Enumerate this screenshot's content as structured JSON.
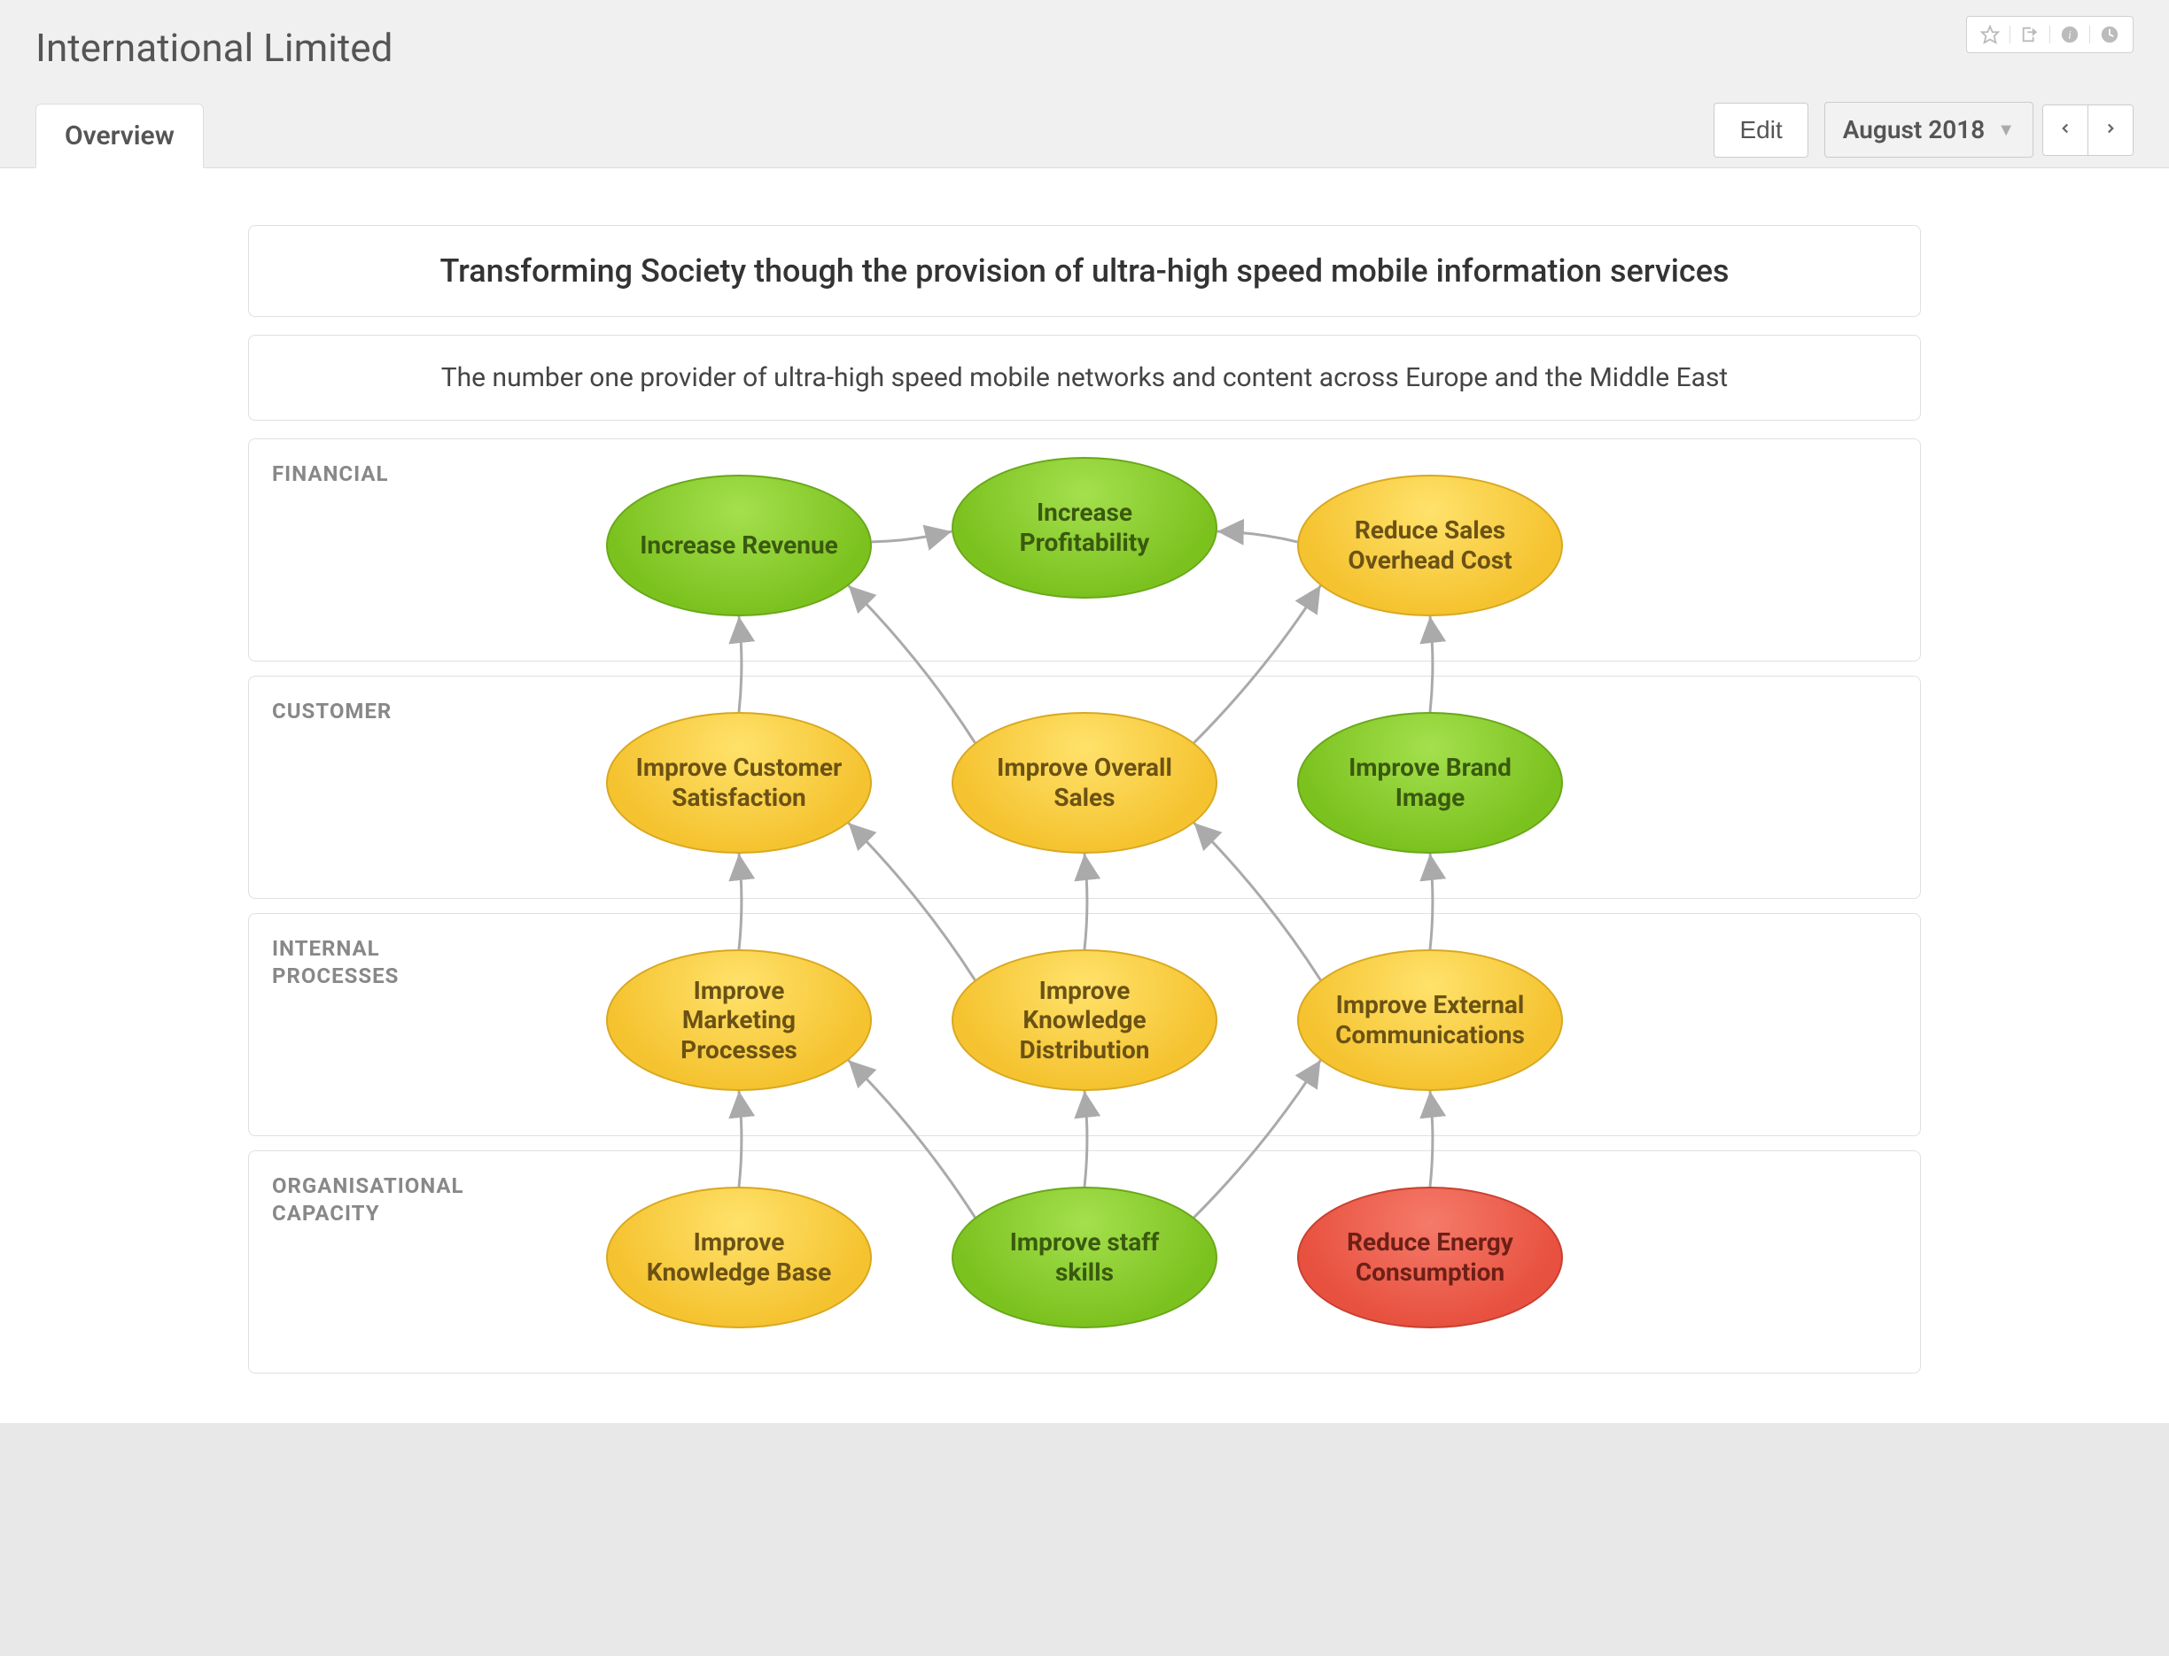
{
  "header": {
    "title": "International Limited",
    "tab_label": "Overview",
    "edit_label": "Edit",
    "period_label": "August 2018"
  },
  "banners": {
    "vision": "Transforming Society though the provision of ultra-high speed mobile information services",
    "mission": "The number one provider of ultra-high speed mobile networks and content across Europe and the Middle East"
  },
  "sections": {
    "financial": {
      "label": "FINANCIAL"
    },
    "customer": {
      "label": "CUSTOMER"
    },
    "internal": {
      "label": "INTERNAL PROCESSES"
    },
    "org": {
      "label": "ORGANISATIONAL CAPACITY"
    }
  },
  "nodes": {
    "increase_revenue": {
      "label": "Increase Revenue",
      "color": "green"
    },
    "increase_profitability": {
      "label": "Increase Profitability",
      "color": "green"
    },
    "reduce_overhead": {
      "label": "Reduce Sales Overhead Cost",
      "color": "yellow"
    },
    "improve_cust_sat": {
      "label": "Improve Customer Satisfaction",
      "color": "yellow"
    },
    "improve_overall_sales": {
      "label": "Improve Overall Sales",
      "color": "yellow"
    },
    "improve_brand": {
      "label": "Improve Brand Image",
      "color": "green"
    },
    "improve_marketing": {
      "label": "Improve Marketing Processes",
      "color": "yellow"
    },
    "improve_knowledge_dist": {
      "label": "Improve Knowledge Distribution",
      "color": "yellow"
    },
    "improve_ext_comms": {
      "label": "Improve External Communications",
      "color": "yellow"
    },
    "improve_knowledge_base": {
      "label": "Improve Knowledge Base",
      "color": "yellow"
    },
    "improve_staff_skills": {
      "label": "Improve staff skills",
      "color": "green"
    },
    "reduce_energy": {
      "label": "Reduce Energy Consumption",
      "color": "red"
    }
  },
  "edges": [
    [
      "increase_revenue",
      "increase_profitability"
    ],
    [
      "reduce_overhead",
      "increase_profitability"
    ],
    [
      "improve_cust_sat",
      "increase_revenue"
    ],
    [
      "improve_overall_sales",
      "increase_revenue"
    ],
    [
      "improve_overall_sales",
      "reduce_overhead"
    ],
    [
      "improve_brand",
      "reduce_overhead"
    ],
    [
      "improve_marketing",
      "improve_cust_sat"
    ],
    [
      "improve_knowledge_dist",
      "improve_cust_sat"
    ],
    [
      "improve_knowledge_dist",
      "improve_overall_sales"
    ],
    [
      "improve_ext_comms",
      "improve_overall_sales"
    ],
    [
      "improve_ext_comms",
      "improve_brand"
    ],
    [
      "improve_knowledge_base",
      "improve_marketing"
    ],
    [
      "improve_staff_skills",
      "improve_marketing"
    ],
    [
      "improve_staff_skills",
      "improve_knowledge_dist"
    ],
    [
      "improve_staff_skills",
      "improve_ext_comms"
    ],
    [
      "reduce_energy",
      "improve_ext_comms"
    ]
  ]
}
